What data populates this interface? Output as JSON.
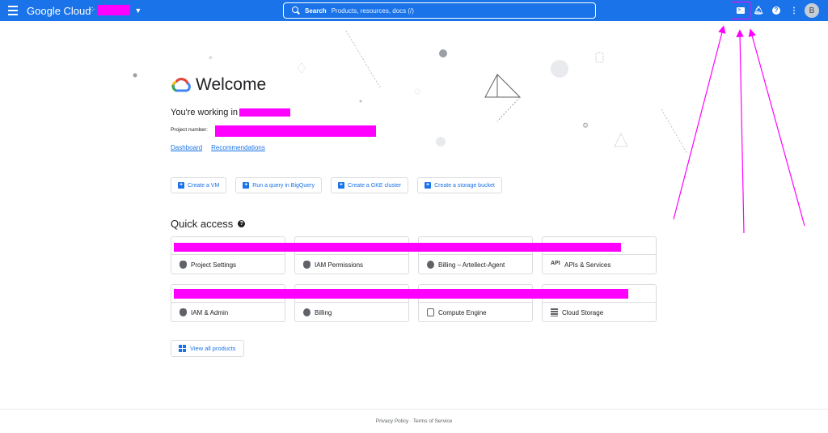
{
  "header": {
    "brand": "Google Cloud",
    "search_label": "Search",
    "search_placeholder": "Products, resources, docs (/)",
    "avatar_initial": "B"
  },
  "welcome": {
    "title": "Welcome",
    "working_in": "You're working in",
    "project_number_label": "Project number:",
    "links": [
      "Dashboard",
      "Recommendations"
    ]
  },
  "actions": [
    "Create a VM",
    "Run a query in BigQuery",
    "Create a GKE cluster",
    "Create a storage bucket"
  ],
  "quick_access": {
    "title": "Quick access",
    "cards": [
      {
        "label": "Project Settings",
        "icon": "shield-icon"
      },
      {
        "label": "IAM Permissions",
        "icon": "shield-icon"
      },
      {
        "label": "Billing – Artellect-Agent",
        "icon": "billing-icon"
      },
      {
        "label": "APIs & Services",
        "icon": "api-icon"
      },
      {
        "label": "IAM & Admin",
        "icon": "shield-icon"
      },
      {
        "label": "Billing",
        "icon": "billing-icon"
      },
      {
        "label": "Compute Engine",
        "icon": "compute-icon"
      },
      {
        "label": "Cloud Storage",
        "icon": "storage-icon"
      }
    ],
    "view_all": "View all products"
  },
  "footer": {
    "text": "Privacy Policy · Terms of Service"
  },
  "colors": {
    "accent": "#1a73e8",
    "redaction": "#ff00ff"
  }
}
